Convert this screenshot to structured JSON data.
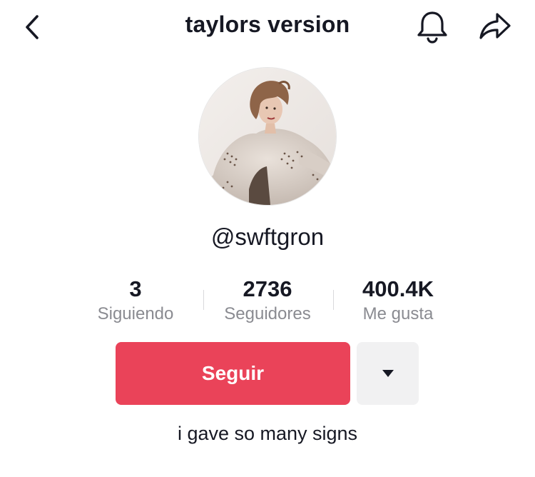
{
  "header": {
    "title": "taylors version",
    "back_icon": "chevron-left-icon",
    "bell_icon": "bell-icon",
    "share_icon": "share-arrow-icon"
  },
  "profile": {
    "username": "@swftgron",
    "avatar": "profile-photo",
    "bio": "i gave so many signs"
  },
  "stats": {
    "following": {
      "value": "3",
      "label": "Siguiendo"
    },
    "followers": {
      "value": "2736",
      "label": "Seguidores"
    },
    "likes": {
      "value": "400.4K",
      "label": "Me gusta"
    }
  },
  "actions": {
    "follow_label": "Seguir",
    "more_icon": "caret-down-icon"
  },
  "colors": {
    "follow_button": "#ea4359",
    "secondary_button": "#f1f1f2",
    "muted_text": "#8a8b91",
    "primary_text": "#161823"
  }
}
